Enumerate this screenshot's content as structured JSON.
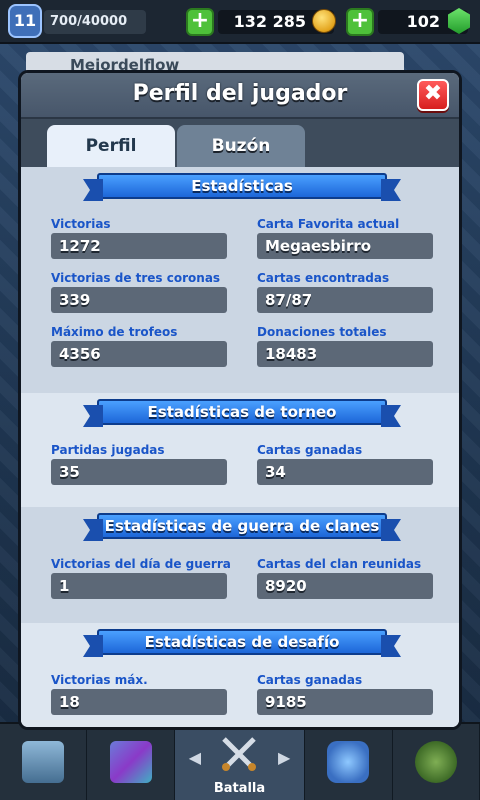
{
  "topbar": {
    "level": "11",
    "xp": "700/40000",
    "gold": "132 285",
    "gems": "102",
    "plus": "+"
  },
  "underlay": {
    "player_name": "Mejordelflow"
  },
  "modal": {
    "title": "Perfil del jugador",
    "close": "✖",
    "tabs": [
      {
        "label": "Perfil",
        "active": true
      },
      {
        "label": "Buzón",
        "active": false
      }
    ]
  },
  "sections": {
    "stats": {
      "title": "Estadísticas",
      "items": [
        {
          "label": "Victorias",
          "value": "1272"
        },
        {
          "label": "Carta Favorita actual",
          "value": "Megaesbirro"
        },
        {
          "label": "Victorias de tres coronas",
          "value": "339"
        },
        {
          "label": "Cartas encontradas",
          "value": "87/87"
        },
        {
          "label": "Máximo de trofeos",
          "value": "4356"
        },
        {
          "label": "Donaciones totales",
          "value": "18483"
        }
      ]
    },
    "tournament": {
      "title": "Estadísticas de torneo",
      "items": [
        {
          "label": "Partidas jugadas",
          "value": "35"
        },
        {
          "label": "Cartas ganadas",
          "value": "34"
        }
      ]
    },
    "clanwar": {
      "title": "Estadísticas de guerra de clanes",
      "items": [
        {
          "label": "Victorias del día de guerra",
          "value": "1"
        },
        {
          "label": "Cartas del clan reunidas",
          "value": "8920"
        }
      ]
    },
    "challenge": {
      "title": "Estadísticas de desafío",
      "items": [
        {
          "label": "Victorias máx.",
          "value": "18"
        },
        {
          "label": "Cartas ganadas",
          "value": "9185"
        }
      ]
    }
  },
  "bottom_nav": {
    "active_label": "Batalla",
    "arrow_left": "◀",
    "arrow_right": "▶"
  }
}
